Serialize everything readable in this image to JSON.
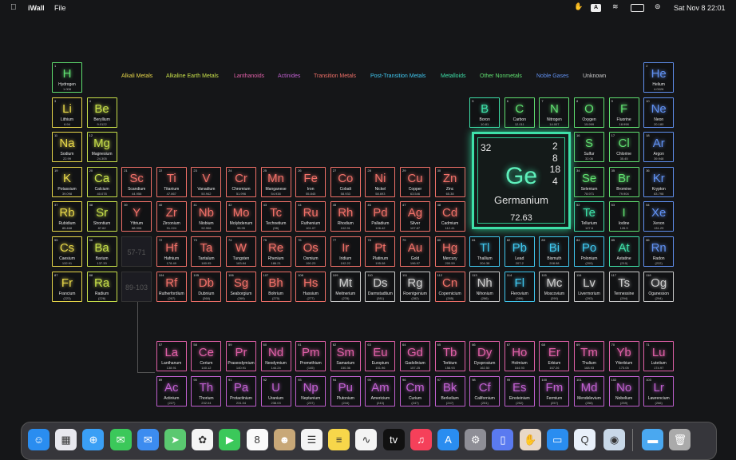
{
  "menubar": {
    "app": "iWall",
    "file": "File",
    "datetime": "Sat Nov 8  22:01",
    "icons": [
      "apple-icon",
      "hand-icon",
      "text-input-icon",
      "wifi-icon",
      "battery-icon",
      "control-center-icon"
    ]
  },
  "legend": [
    {
      "label": "Alkali Metals",
      "color": "#e8d84a"
    },
    {
      "label": "Alkaline Earth Metals",
      "color": "#c8e04a"
    },
    {
      "label": "Lanthanoids",
      "color": "#e060a8"
    },
    {
      "label": "Actinides",
      "color": "#c060d0"
    },
    {
      "label": "Transition Metals",
      "color": "#f07068"
    },
    {
      "label": "Post-Transition Metals",
      "color": "#40c8f0"
    },
    {
      "label": "Metalloids",
      "color": "#3ee0a8"
    },
    {
      "label": "Other Nonmetals",
      "color": "#60e070"
    },
    {
      "label": "Noble Gases",
      "color": "#6090f0"
    },
    {
      "label": "Unknown",
      "color": "#cccccc"
    }
  ],
  "elements": [
    {
      "n": "1",
      "s": "H",
      "name": "Hydrogen",
      "m": "1.008",
      "t": 7,
      "r": 1,
      "c": 1
    },
    {
      "n": "2",
      "s": "He",
      "name": "Helium",
      "m": "4.0026",
      "t": 8,
      "r": 1,
      "c": 18
    },
    {
      "n": "3",
      "s": "Li",
      "name": "Lithium",
      "m": "6.94",
      "t": 0,
      "r": 2,
      "c": 1
    },
    {
      "n": "4",
      "s": "Be",
      "name": "Beryllium",
      "m": "9.0122",
      "t": 1,
      "r": 2,
      "c": 2
    },
    {
      "n": "5",
      "s": "B",
      "name": "Boron",
      "m": "10.81",
      "t": 6,
      "r": 2,
      "c": 13
    },
    {
      "n": "6",
      "s": "C",
      "name": "Carbon",
      "m": "12.011",
      "t": 7,
      "r": 2,
      "c": 14
    },
    {
      "n": "7",
      "s": "N",
      "name": "Nitrogen",
      "m": "14.007",
      "t": 7,
      "r": 2,
      "c": 15
    },
    {
      "n": "8",
      "s": "O",
      "name": "Oxygen",
      "m": "15.999",
      "t": 7,
      "r": 2,
      "c": 16
    },
    {
      "n": "9",
      "s": "F",
      "name": "Fluorine",
      "m": "18.998",
      "t": 7,
      "r": 2,
      "c": 17
    },
    {
      "n": "10",
      "s": "Ne",
      "name": "Neon",
      "m": "20.180",
      "t": 8,
      "r": 2,
      "c": 18
    },
    {
      "n": "11",
      "s": "Na",
      "name": "Sodium",
      "m": "22.99",
      "t": 0,
      "r": 3,
      "c": 1
    },
    {
      "n": "12",
      "s": "Mg",
      "name": "Magnesium",
      "m": "24.305",
      "t": 1,
      "r": 3,
      "c": 2
    },
    {
      "n": "16",
      "s": "S",
      "name": "Sulfur",
      "m": "32.06",
      "t": 7,
      "r": 3,
      "c": 16
    },
    {
      "n": "17",
      "s": "Cl",
      "name": "Chlorine",
      "m": "35.45",
      "t": 7,
      "r": 3,
      "c": 17
    },
    {
      "n": "18",
      "s": "Ar",
      "name": "Argon",
      "m": "39.948",
      "t": 8,
      "r": 3,
      "c": 18
    },
    {
      "n": "19",
      "s": "K",
      "name": "Potassium",
      "m": "39.098",
      "t": 0,
      "r": 4,
      "c": 1
    },
    {
      "n": "20",
      "s": "Ca",
      "name": "Calcium",
      "m": "40.078",
      "t": 1,
      "r": 4,
      "c": 2
    },
    {
      "n": "21",
      "s": "Sc",
      "name": "Scandium",
      "m": "44.956",
      "t": 4,
      "r": 4,
      "c": 3
    },
    {
      "n": "22",
      "s": "Ti",
      "name": "Titanium",
      "m": "47.867",
      "t": 4,
      "r": 4,
      "c": 4
    },
    {
      "n": "23",
      "s": "V",
      "name": "Vanadium",
      "m": "50.942",
      "t": 4,
      "r": 4,
      "c": 5
    },
    {
      "n": "24",
      "s": "Cr",
      "name": "Chromium",
      "m": "51.996",
      "t": 4,
      "r": 4,
      "c": 6
    },
    {
      "n": "25",
      "s": "Mn",
      "name": "Manganese",
      "m": "54.938",
      "t": 4,
      "r": 4,
      "c": 7
    },
    {
      "n": "26",
      "s": "Fe",
      "name": "Iron",
      "m": "55.845",
      "t": 4,
      "r": 4,
      "c": 8
    },
    {
      "n": "27",
      "s": "Co",
      "name": "Cobalt",
      "m": "58.933",
      "t": 4,
      "r": 4,
      "c": 9
    },
    {
      "n": "28",
      "s": "Ni",
      "name": "Nickel",
      "m": "58.693",
      "t": 4,
      "r": 4,
      "c": 10
    },
    {
      "n": "29",
      "s": "Cu",
      "name": "Copper",
      "m": "63.546",
      "t": 4,
      "r": 4,
      "c": 11
    },
    {
      "n": "30",
      "s": "Zn",
      "name": "Zinc",
      "m": "65.38",
      "t": 4,
      "r": 4,
      "c": 12
    },
    {
      "n": "34",
      "s": "Se",
      "name": "Selenium",
      "m": "78.971",
      "t": 7,
      "r": 4,
      "c": 16
    },
    {
      "n": "35",
      "s": "Br",
      "name": "Bromine",
      "m": "79.904",
      "t": 7,
      "r": 4,
      "c": 17
    },
    {
      "n": "36",
      "s": "Kr",
      "name": "Krypton",
      "m": "83.798",
      "t": 8,
      "r": 4,
      "c": 18
    },
    {
      "n": "37",
      "s": "Rb",
      "name": "Rubidium",
      "m": "85.468",
      "t": 0,
      "r": 5,
      "c": 1
    },
    {
      "n": "38",
      "s": "Sr",
      "name": "Strontium",
      "m": "87.62",
      "t": 1,
      "r": 5,
      "c": 2
    },
    {
      "n": "39",
      "s": "Y",
      "name": "Yttrium",
      "m": "88.906",
      "t": 4,
      "r": 5,
      "c": 3
    },
    {
      "n": "40",
      "s": "Zr",
      "name": "Zirconium",
      "m": "91.224",
      "t": 4,
      "r": 5,
      "c": 4
    },
    {
      "n": "41",
      "s": "Nb",
      "name": "Niobium",
      "m": "92.906",
      "t": 4,
      "r": 5,
      "c": 5
    },
    {
      "n": "42",
      "s": "Mo",
      "name": "Molybdenum",
      "m": "95.95",
      "t": 4,
      "r": 5,
      "c": 6
    },
    {
      "n": "43",
      "s": "Tc",
      "name": "Technetium",
      "m": "(98)",
      "t": 4,
      "r": 5,
      "c": 7
    },
    {
      "n": "44",
      "s": "Ru",
      "name": "Ruthenium",
      "m": "101.07",
      "t": 4,
      "r": 5,
      "c": 8
    },
    {
      "n": "45",
      "s": "Rh",
      "name": "Rhodium",
      "m": "102.91",
      "t": 4,
      "r": 5,
      "c": 9
    },
    {
      "n": "46",
      "s": "Pd",
      "name": "Palladium",
      "m": "106.42",
      "t": 4,
      "r": 5,
      "c": 10
    },
    {
      "n": "47",
      "s": "Ag",
      "name": "Silver",
      "m": "107.87",
      "t": 4,
      "r": 5,
      "c": 11
    },
    {
      "n": "48",
      "s": "Cd",
      "name": "Cadmium",
      "m": "112.41",
      "t": 4,
      "r": 5,
      "c": 12
    },
    {
      "n": "52",
      "s": "Te",
      "name": "Tellurium",
      "m": "127.6",
      "t": 6,
      "r": 5,
      "c": 16
    },
    {
      "n": "53",
      "s": "I",
      "name": "Iodine",
      "m": "126.9",
      "t": 7,
      "r": 5,
      "c": 17
    },
    {
      "n": "54",
      "s": "Xe",
      "name": "Xenon",
      "m": "131.29",
      "t": 8,
      "r": 5,
      "c": 18
    },
    {
      "n": "55",
      "s": "Cs",
      "name": "Caesium",
      "m": "132.91",
      "t": 0,
      "r": 6,
      "c": 1
    },
    {
      "n": "56",
      "s": "Ba",
      "name": "Barium",
      "m": "137.33",
      "t": 1,
      "r": 6,
      "c": 2
    },
    {
      "n": "72",
      "s": "Hf",
      "name": "Hafnium",
      "m": "178.49",
      "t": 4,
      "r": 6,
      "c": 4
    },
    {
      "n": "73",
      "s": "Ta",
      "name": "Tantalum",
      "m": "180.95",
      "t": 4,
      "r": 6,
      "c": 5
    },
    {
      "n": "74",
      "s": "W",
      "name": "Tungsten",
      "m": "183.84",
      "t": 4,
      "r": 6,
      "c": 6
    },
    {
      "n": "75",
      "s": "Re",
      "name": "Rhenium",
      "m": "186.21",
      "t": 4,
      "r": 6,
      "c": 7
    },
    {
      "n": "76",
      "s": "Os",
      "name": "Osmium",
      "m": "190.23",
      "t": 4,
      "r": 6,
      "c": 8
    },
    {
      "n": "77",
      "s": "Ir",
      "name": "Iridium",
      "m": "192.22",
      "t": 4,
      "r": 6,
      "c": 9
    },
    {
      "n": "78",
      "s": "Pt",
      "name": "Platinum",
      "m": "195.08",
      "t": 4,
      "r": 6,
      "c": 10
    },
    {
      "n": "79",
      "s": "Au",
      "name": "Gold",
      "m": "196.97",
      "t": 4,
      "r": 6,
      "c": 11
    },
    {
      "n": "80",
      "s": "Hg",
      "name": "Mercury",
      "m": "200.59",
      "t": 4,
      "r": 6,
      "c": 12
    },
    {
      "n": "81",
      "s": "Tl",
      "name": "Thallium",
      "m": "204.38",
      "t": 5,
      "r": 6,
      "c": 13
    },
    {
      "n": "82",
      "s": "Pb",
      "name": "Lead",
      "m": "207.2",
      "t": 5,
      "r": 6,
      "c": 14
    },
    {
      "n": "83",
      "s": "Bi",
      "name": "Bismuth",
      "m": "208.98",
      "t": 5,
      "r": 6,
      "c": 15
    },
    {
      "n": "84",
      "s": "Po",
      "name": "Polonium",
      "m": "(209)",
      "t": 5,
      "r": 6,
      "c": 16
    },
    {
      "n": "85",
      "s": "At",
      "name": "Astatine",
      "m": "(210)",
      "t": 6,
      "r": 6,
      "c": 17
    },
    {
      "n": "86",
      "s": "Rn",
      "name": "Radon",
      "m": "(222)",
      "t": 8,
      "r": 6,
      "c": 18
    },
    {
      "n": "87",
      "s": "Fr",
      "name": "Francium",
      "m": "(223)",
      "t": 0,
      "r": 7,
      "c": 1
    },
    {
      "n": "88",
      "s": "Ra",
      "name": "Radium",
      "m": "(226)",
      "t": 1,
      "r": 7,
      "c": 2
    },
    {
      "n": "104",
      "s": "Rf",
      "name": "Rutherfordium",
      "m": "(267)",
      "t": 4,
      "r": 7,
      "c": 4
    },
    {
      "n": "105",
      "s": "Db",
      "name": "Dubnium",
      "m": "(268)",
      "t": 4,
      "r": 7,
      "c": 5
    },
    {
      "n": "106",
      "s": "Sg",
      "name": "Seaborgium",
      "m": "(269)",
      "t": 4,
      "r": 7,
      "c": 6
    },
    {
      "n": "107",
      "s": "Bh",
      "name": "Bohrium",
      "m": "(270)",
      "t": 4,
      "r": 7,
      "c": 7
    },
    {
      "n": "108",
      "s": "Hs",
      "name": "Hassium",
      "m": "(277)",
      "t": 4,
      "r": 7,
      "c": 8
    },
    {
      "n": "109",
      "s": "Mt",
      "name": "Meitnerium",
      "m": "(278)",
      "t": 9,
      "r": 7,
      "c": 9
    },
    {
      "n": "110",
      "s": "Ds",
      "name": "Darmstadtium",
      "m": "(281)",
      "t": 9,
      "r": 7,
      "c": 10
    },
    {
      "n": "111",
      "s": "Rg",
      "name": "Roentgenium",
      "m": "(282)",
      "t": 9,
      "r": 7,
      "c": 11
    },
    {
      "n": "112",
      "s": "Cn",
      "name": "Copernicium",
      "m": "(285)",
      "t": 4,
      "r": 7,
      "c": 12
    },
    {
      "n": "113",
      "s": "Nh",
      "name": "Nihonium",
      "m": "(286)",
      "t": 9,
      "r": 7,
      "c": 13
    },
    {
      "n": "114",
      "s": "Fl",
      "name": "Flerovium",
      "m": "(289)",
      "t": 5,
      "r": 7,
      "c": 14
    },
    {
      "n": "115",
      "s": "Mc",
      "name": "Moscovium",
      "m": "(290)",
      "t": 9,
      "r": 7,
      "c": 15
    },
    {
      "n": "116",
      "s": "Lv",
      "name": "Livermorium",
      "m": "(293)",
      "t": 9,
      "r": 7,
      "c": 16
    },
    {
      "n": "117",
      "s": "Ts",
      "name": "Tennessine",
      "m": "(294)",
      "t": 9,
      "r": 7,
      "c": 17
    },
    {
      "n": "118",
      "s": "Og",
      "name": "Oganesson",
      "m": "(294)",
      "t": 9,
      "r": 7,
      "c": 18
    },
    {
      "n": "57",
      "s": "La",
      "name": "Lanthanum",
      "m": "138.91",
      "t": 2,
      "r": 8,
      "c": 4
    },
    {
      "n": "58",
      "s": "Ce",
      "name": "Cerium",
      "m": "140.12",
      "t": 2,
      "r": 8,
      "c": 5
    },
    {
      "n": "59",
      "s": "Pr",
      "name": "Praseodymium",
      "m": "140.91",
      "t": 2,
      "r": 8,
      "c": 6
    },
    {
      "n": "60",
      "s": "Nd",
      "name": "Neodymium",
      "m": "144.24",
      "t": 2,
      "r": 8,
      "c": 7
    },
    {
      "n": "61",
      "s": "Pm",
      "name": "Promethium",
      "m": "(145)",
      "t": 2,
      "r": 8,
      "c": 8
    },
    {
      "n": "62",
      "s": "Sm",
      "name": "Samarium",
      "m": "150.36",
      "t": 2,
      "r": 8,
      "c": 9
    },
    {
      "n": "63",
      "s": "Eu",
      "name": "Europium",
      "m": "151.96",
      "t": 2,
      "r": 8,
      "c": 10
    },
    {
      "n": "64",
      "s": "Gd",
      "name": "Gadolinium",
      "m": "157.25",
      "t": 2,
      "r": 8,
      "c": 11
    },
    {
      "n": "65",
      "s": "Tb",
      "name": "Terbium",
      "m": "158.93",
      "t": 2,
      "r": 8,
      "c": 12
    },
    {
      "n": "66",
      "s": "Dy",
      "name": "Dysprosium",
      "m": "162.50",
      "t": 2,
      "r": 8,
      "c": 13
    },
    {
      "n": "67",
      "s": "Ho",
      "name": "Holmium",
      "m": "164.93",
      "t": 2,
      "r": 8,
      "c": 14
    },
    {
      "n": "68",
      "s": "Er",
      "name": "Erbium",
      "m": "167.26",
      "t": 2,
      "r": 8,
      "c": 15
    },
    {
      "n": "69",
      "s": "Tm",
      "name": "Thulium",
      "m": "168.93",
      "t": 2,
      "r": 8,
      "c": 16
    },
    {
      "n": "70",
      "s": "Yb",
      "name": "Ytterbium",
      "m": "173.05",
      "t": 2,
      "r": 8,
      "c": 17
    },
    {
      "n": "71",
      "s": "Lu",
      "name": "Lutetium",
      "m": "174.97",
      "t": 2,
      "r": 8,
      "c": 18
    },
    {
      "n": "89",
      "s": "Ac",
      "name": "Actinium",
      "m": "(227)",
      "t": 3,
      "r": 9,
      "c": 4
    },
    {
      "n": "90",
      "s": "Th",
      "name": "Thorium",
      "m": "232.04",
      "t": 3,
      "r": 9,
      "c": 5
    },
    {
      "n": "91",
      "s": "Pa",
      "name": "Protactinium",
      "m": "231.04",
      "t": 3,
      "r": 9,
      "c": 6
    },
    {
      "n": "92",
      "s": "U",
      "name": "Uranium",
      "m": "238.03",
      "t": 3,
      "r": 9,
      "c": 7
    },
    {
      "n": "93",
      "s": "Np",
      "name": "Neptunium",
      "m": "(237)",
      "t": 3,
      "r": 9,
      "c": 8
    },
    {
      "n": "94",
      "s": "Pu",
      "name": "Plutonium",
      "m": "(244)",
      "t": 3,
      "r": 9,
      "c": 9
    },
    {
      "n": "95",
      "s": "Am",
      "name": "Americium",
      "m": "(243)",
      "t": 3,
      "r": 9,
      "c": 10
    },
    {
      "n": "96",
      "s": "Cm",
      "name": "Curium",
      "m": "(247)",
      "t": 3,
      "r": 9,
      "c": 11
    },
    {
      "n": "97",
      "s": "Bk",
      "name": "Berkelium",
      "m": "(247)",
      "t": 3,
      "r": 9,
      "c": 12
    },
    {
      "n": "98",
      "s": "Cf",
      "name": "Californium",
      "m": "(251)",
      "t": 3,
      "r": 9,
      "c": 13
    },
    {
      "n": "99",
      "s": "Es",
      "name": "Einsteinium",
      "m": "(252)",
      "t": 3,
      "r": 9,
      "c": 14
    },
    {
      "n": "100",
      "s": "Fm",
      "name": "Fermium",
      "m": "(257)",
      "t": 3,
      "r": 9,
      "c": 15
    },
    {
      "n": "101",
      "s": "Md",
      "name": "Mendelevium",
      "m": "(258)",
      "t": 3,
      "r": 9,
      "c": 16
    },
    {
      "n": "102",
      "s": "No",
      "name": "Nobelium",
      "m": "(259)",
      "t": 3,
      "r": 9,
      "c": 17
    },
    {
      "n": "103",
      "s": "Lr",
      "name": "Lawrencium",
      "m": "(266)",
      "t": 3,
      "r": 9,
      "c": 18
    }
  ],
  "placeholders": {
    "lanthanoids": "57-71",
    "actinides": "89-103"
  },
  "featured": {
    "number": "32",
    "symbol": "Ge",
    "name": "Germanium",
    "mass": "72.63",
    "shells": [
      "2",
      "8",
      "18",
      "4"
    ]
  },
  "dock": [
    {
      "name": "finder-icon",
      "color": "#2a8df0",
      "glyph": "☺"
    },
    {
      "name": "launchpad-icon",
      "color": "#e8e8ee",
      "glyph": "▦"
    },
    {
      "name": "safari-icon",
      "color": "#3a9ff5",
      "glyph": "⊕"
    },
    {
      "name": "messages-icon",
      "color": "#3bc85a",
      "glyph": "✉"
    },
    {
      "name": "mail-icon",
      "color": "#3c8cf0",
      "glyph": "✉"
    },
    {
      "name": "maps-icon",
      "color": "#5ac870",
      "glyph": "➤"
    },
    {
      "name": "photos-icon",
      "color": "#f4f4f4",
      "glyph": "✿"
    },
    {
      "name": "facetime-icon",
      "color": "#3bc85a",
      "glyph": "▶"
    },
    {
      "name": "calendar-icon",
      "color": "#fafafa",
      "glyph": "8"
    },
    {
      "name": "contacts-icon",
      "color": "#c8a878",
      "glyph": "☻"
    },
    {
      "name": "reminders-icon",
      "color": "#f4f4f4",
      "glyph": "☰"
    },
    {
      "name": "notes-icon",
      "color": "#f7d64a",
      "glyph": "≡"
    },
    {
      "name": "freeform-icon",
      "color": "#f4f4f4",
      "glyph": "∿"
    },
    {
      "name": "tv-icon",
      "color": "#111111",
      "glyph": "tv"
    },
    {
      "name": "music-icon",
      "color": "#f5405a",
      "glyph": "♫"
    },
    {
      "name": "app-store-icon",
      "color": "#2a8df0",
      "glyph": "A"
    },
    {
      "name": "system-settings-icon",
      "color": "#8e8e96",
      "glyph": "⚙"
    },
    {
      "name": "iphone-mirroring-icon",
      "color": "#5a7af0",
      "glyph": "▯"
    },
    {
      "name": "iwall-icon",
      "color": "#e8d8c8",
      "glyph": "✋"
    },
    {
      "name": "remote-desktop-icon",
      "color": "#2a8df0",
      "glyph": "▭"
    },
    {
      "name": "quicktime-icon",
      "color": "#e8f0fa",
      "glyph": "Q"
    },
    {
      "name": "disk-utility-icon",
      "color": "#c8d8e8",
      "glyph": "◉"
    },
    {
      "name": "folder-icon",
      "color": "#4aa8f0",
      "glyph": "▬"
    },
    {
      "name": "trash-icon",
      "color": "#aaaaaa",
      "glyph": "🗑"
    }
  ]
}
